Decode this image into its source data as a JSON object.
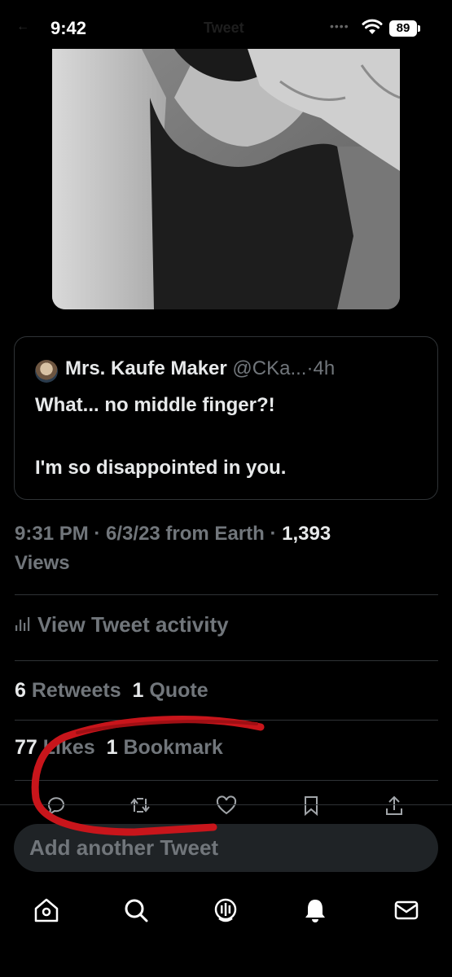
{
  "status_bar": {
    "time": "9:42",
    "title": "Tweet",
    "battery": "89",
    "icons": [
      "signal-dots-icon",
      "wifi-icon",
      "battery-icon"
    ]
  },
  "quote": {
    "name": "Mrs. Kaufe Maker",
    "handle": "@CKa...",
    "separator": "·",
    "age": "4h",
    "line1": "What... no middle finger?!",
    "line2": "I'm so disappointed in you."
  },
  "meta": {
    "time": "9:31 PM",
    "sep1": " · ",
    "date": "6/3/23",
    "source": " from Earth",
    "sep2": " · ",
    "views_count": "1,393",
    "views_label": "Views"
  },
  "activity": {
    "label": "View Tweet activity"
  },
  "stats": {
    "retweets_count": "6",
    "retweets_label": "Retweets",
    "quotes_count": "1",
    "quotes_label": "Quote",
    "likes_count": "77",
    "likes_label": "Likes",
    "bookmarks_count": "1",
    "bookmarks_label": "Bookmark"
  },
  "actions": [
    "reply-icon",
    "retweet-icon",
    "like-icon",
    "bookmark-icon",
    "share-icon"
  ],
  "reply_bar": {
    "placeholder": "Add another Tweet"
  },
  "bottom_nav": [
    "home-icon",
    "search-icon",
    "spaces-icon",
    "notifications-icon",
    "messages-icon"
  ],
  "colors": {
    "background": "#000000",
    "primary_text": "#e7e9ea",
    "secondary_text": "#71767b",
    "divider": "#2f3336",
    "annotation": "#c8151b"
  }
}
